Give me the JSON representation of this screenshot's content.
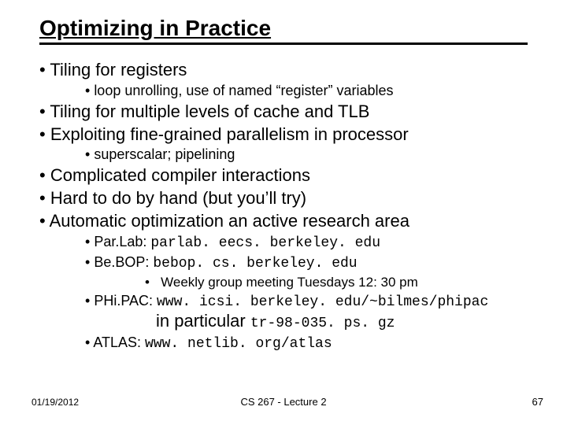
{
  "title": "Optimizing in Practice",
  "b1": "Tiling for registers",
  "b1s1": "loop unrolling, use of named “register” variables",
  "b2": "Tiling for multiple levels of cache and TLB",
  "b3": "Exploiting fine-grained parallelism in processor",
  "b3s1": "superscalar; pipelining",
  "b4": "Complicated compiler interactions",
  "b5": "Hard to do by hand (but you’ll try)",
  "b6": "Automatic optimization an active research area",
  "b6s1_label": "Par.Lab: ",
  "b6s1_url": "parlab. eecs. berkeley. edu",
  "b6s2_label": "Be.BOP: ",
  "b6s2_url": "bebop. cs. berkeley. edu",
  "b6s2s1": "Weekly group meeting Tuesdays 12: 30 pm",
  "b6s3_label": "PHi.PAC: ",
  "b6s3_url": "www. icsi. berkeley. edu/~bilmes/phipac",
  "b6s3_line2a": "in particular ",
  "b6s3_line2b": "tr-98-035. ps. gz",
  "b6s4_label": "ATLAS: ",
  "b6s4_url": "www. netlib. org/atlas",
  "footer_date": "01/19/2012",
  "footer_center": "CS 267 - Lecture 2",
  "footer_page": "67"
}
